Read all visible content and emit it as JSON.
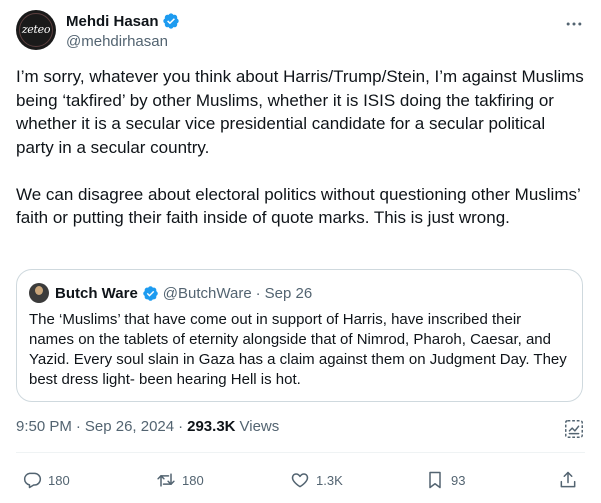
{
  "author": {
    "name": "Mehdi Hasan",
    "handle": "@mehdirhasan",
    "avatar_text": "zeteo",
    "verified_color": "#1d9bf0"
  },
  "tweet": {
    "paragraphs": [
      "I’m sorry, whatever you think about Harris/Trump/Stein, I’m against Muslims being ‘takfired’ by other Muslims, whether it is ISIS doing the takfiring or whether it is a secular vice presidential candidate for a secular political party in a secular country.",
      "We can disagree about electoral politics without questioning other Muslims’ faith or putting their faith inside of quote marks. This is just wrong."
    ]
  },
  "quote": {
    "name": "Butch Ware",
    "handle": "@ButchWare",
    "separator": "·",
    "date": "Sep 26",
    "text": "The ‘Muslims’ that have come out in support of Harris, have inscribed their names on the tablets of eternity alongside that of Nimrod, Pharoh, Caesar, and Yazid. Every soul slain in Gaza has a claim against them on Judgment Day. They best dress light- been hearing Hell is hot."
  },
  "meta": {
    "time": "9:50 PM",
    "dot1": "·",
    "date": "Sep 26, 2024",
    "dot2": "·",
    "views_count": "293.3K",
    "views_label": "Views"
  },
  "actions": {
    "replies": "180",
    "reposts": "180",
    "likes": "1.3K",
    "bookmarks": "93"
  },
  "icons": [
    "verified-badge-icon",
    "more-icon",
    "grok-icon",
    "reply-icon",
    "repost-icon",
    "like-icon",
    "bookmark-icon",
    "share-icon"
  ],
  "colors": {
    "text": "#0f1419",
    "secondary": "#536471",
    "border": "#cfd9de",
    "verified": "#1d9bf0"
  }
}
